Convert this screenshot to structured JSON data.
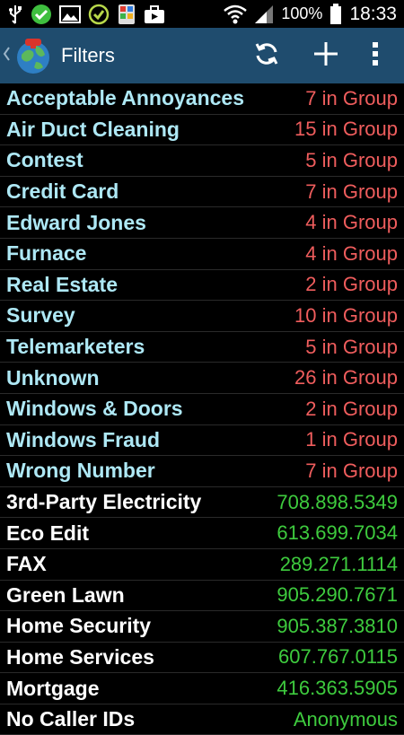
{
  "status_bar": {
    "battery": "100%",
    "time": "18:33",
    "icons": [
      "usb-icon",
      "check-icon",
      "image-icon",
      "check-circle-icon",
      "app-shortcut-icon",
      "briefcase-icon",
      "wifi-icon",
      "signal-icon",
      "battery-icon"
    ]
  },
  "action_bar": {
    "title": "Filters",
    "actions": [
      "refresh-icon",
      "add-icon",
      "overflow-menu-icon"
    ]
  },
  "colors": {
    "action_bar_bg": "#1f4c6e",
    "group_name": "#aee8f5",
    "group_count": "#ef5d5d",
    "number_name": "#ffffff",
    "number_value": "#3ecb3e",
    "clock": "#ffffff"
  },
  "groups": [
    {
      "name": "Acceptable Annoyances",
      "count": "7 in Group"
    },
    {
      "name": "Air Duct Cleaning",
      "count": "15 in Group"
    },
    {
      "name": "Contest",
      "count": "5 in Group"
    },
    {
      "name": "Credit Card",
      "count": "7 in Group"
    },
    {
      "name": "Edward Jones",
      "count": "4 in Group"
    },
    {
      "name": "Furnace",
      "count": "4 in Group"
    },
    {
      "name": "Real Estate",
      "count": "2 in Group"
    },
    {
      "name": "Survey",
      "count": "10 in Group"
    },
    {
      "name": "Telemarketers",
      "count": "5 in Group"
    },
    {
      "name": "Unknown",
      "count": "26 in Group"
    },
    {
      "name": "Windows & Doors",
      "count": "2 in Group"
    },
    {
      "name": "Windows Fraud",
      "count": "1 in Group"
    },
    {
      "name": "Wrong Number",
      "count": "7 in Group"
    }
  ],
  "numbers": [
    {
      "name": "3rd-Party Electricity",
      "value": "708.898.5349"
    },
    {
      "name": "Eco Edit",
      "value": "613.699.7034"
    },
    {
      "name": "FAX",
      "value": "289.271.1114"
    },
    {
      "name": "Green Lawn",
      "value": "905.290.7671"
    },
    {
      "name": "Home Security",
      "value": "905.387.3810"
    },
    {
      "name": "Home Services",
      "value": "607.767.0115"
    },
    {
      "name": "Mortgage",
      "value": "416.363.5905"
    },
    {
      "name": "No Caller IDs",
      "value": "Anonymous"
    }
  ]
}
